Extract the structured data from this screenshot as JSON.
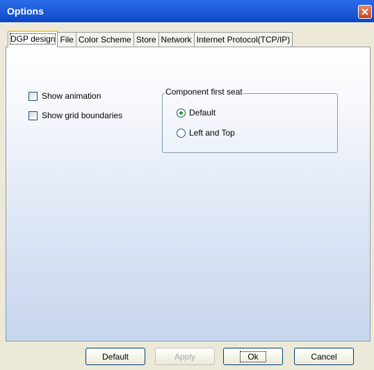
{
  "window": {
    "title": "Options"
  },
  "tabs": [
    {
      "label": "DGP design",
      "active": true
    },
    {
      "label": "File"
    },
    {
      "label": "Color Scheme"
    },
    {
      "label": "Store"
    },
    {
      "label": "Network"
    },
    {
      "label": "Internet Protocol(TCP/IP)"
    }
  ],
  "options": {
    "show_animation": {
      "label": "Show animation",
      "checked": false
    },
    "show_grid_boundaries": {
      "label": "Show grid boundaries",
      "checked": false
    }
  },
  "component_first_seat": {
    "legend": "Component first seat",
    "default_label": "Default",
    "left_top_label": "Left and Top",
    "selected": "Default"
  },
  "buttons": {
    "default": "Default",
    "apply": "Apply",
    "ok": "Ok",
    "cancel": "Cancel"
  }
}
